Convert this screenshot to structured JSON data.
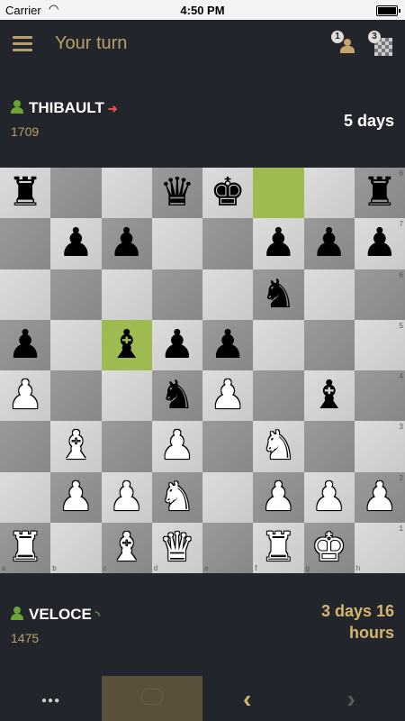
{
  "status_bar": {
    "carrier": "Carrier",
    "time": "4:50 PM"
  },
  "header": {
    "title": "Your turn",
    "friends_count": "1",
    "games_count": "3"
  },
  "accent_color": "#b8a06a",
  "opponent": {
    "name": "THIBAULT",
    "rating": "1709",
    "time_left": "5 days",
    "status_icon": "exit-icon"
  },
  "player": {
    "name": "VELOCE",
    "rating": "1475",
    "time_left": "3 days 16 hours",
    "status_icon": "rss-feed-icon"
  },
  "board": {
    "rank_labels": [
      "8",
      "7",
      "6",
      "5",
      "4",
      "3",
      "2",
      "1"
    ],
    "file_labels": [
      "a",
      "b",
      "c",
      "d",
      "e",
      "f",
      "g",
      "h"
    ],
    "highlight_squares": [
      "f8",
      "c5"
    ],
    "rows": [
      [
        "r",
        "",
        "",
        "q",
        "k",
        "",
        "",
        "r"
      ],
      [
        "",
        "p",
        "p",
        "",
        "",
        "p",
        "p",
        "p"
      ],
      [
        "",
        "",
        "",
        "",
        "",
        "n",
        "",
        ""
      ],
      [
        "p",
        "",
        "b",
        "p",
        "p",
        "",
        "",
        ""
      ],
      [
        "P",
        "",
        "",
        "n",
        "P",
        "",
        "b",
        ""
      ],
      [
        "",
        "B",
        "",
        "P",
        "",
        "N",
        "",
        ""
      ],
      [
        "",
        "P",
        "P",
        "N",
        "",
        "P",
        "P",
        "P"
      ],
      [
        "R",
        "",
        "B",
        "Q",
        "",
        "R",
        "K",
        ""
      ]
    ]
  },
  "bottom_bar": {
    "more_icon": "more-dots-icon",
    "center_icon": "analysis-icon",
    "prev_icon": "chevron-left-icon",
    "next_icon": "chevron-right-icon"
  }
}
